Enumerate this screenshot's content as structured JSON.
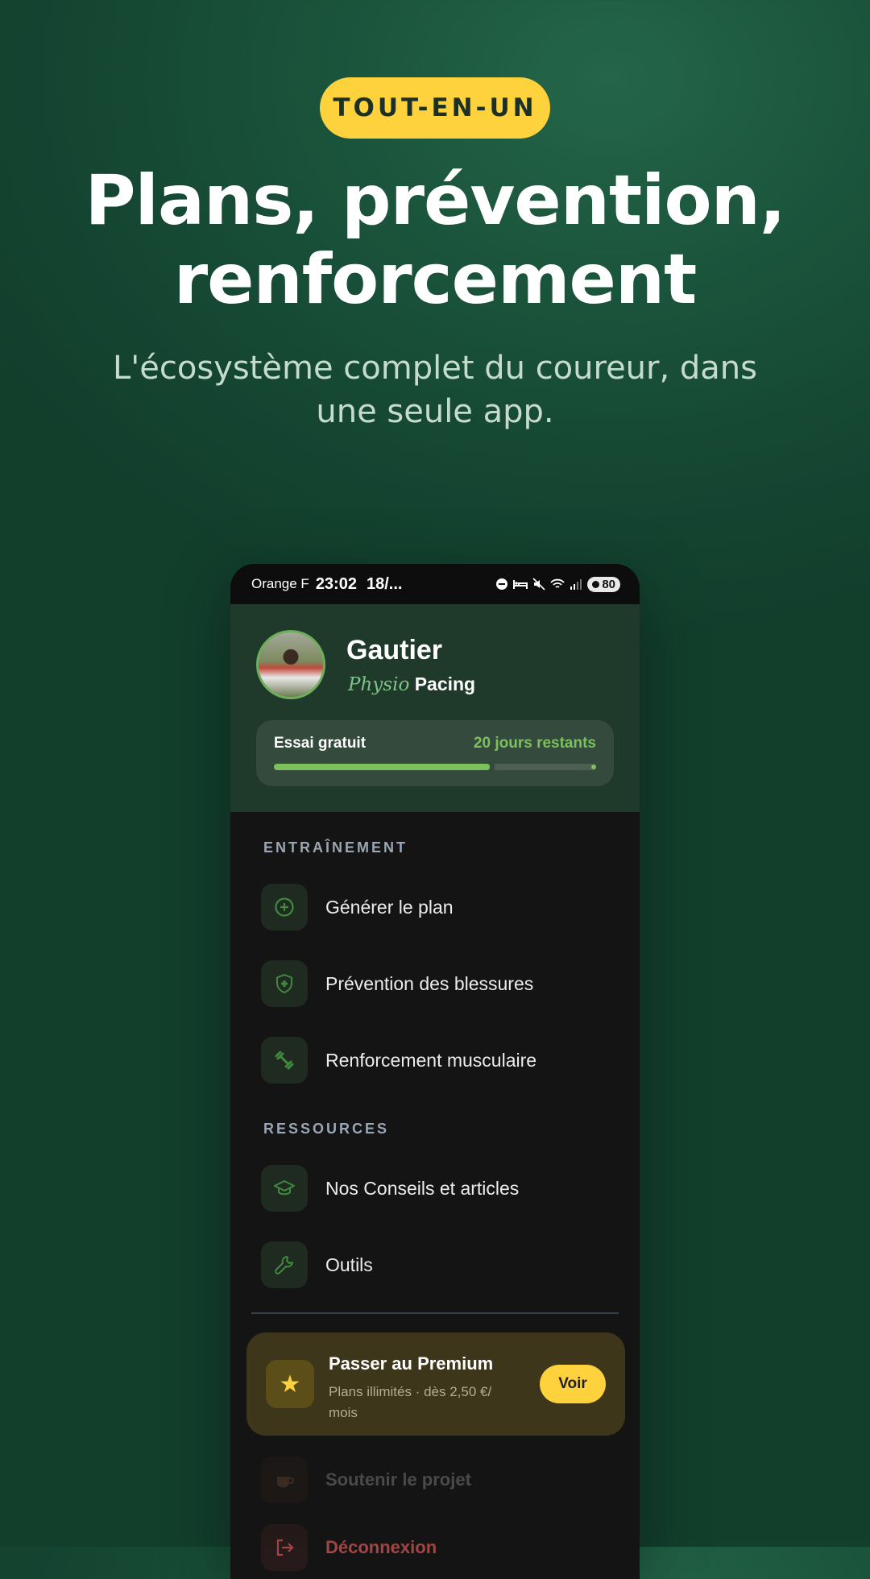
{
  "hero": {
    "badge": "TOUT-EN-UN",
    "headline_line1": "Plans, prévention,",
    "headline_line2": "renforcement",
    "subtitle": "L'écosystème complet du coureur, dans une seule app."
  },
  "status_bar": {
    "carrier": "Orange F",
    "time": "23:02",
    "date": "18/...",
    "battery": "80"
  },
  "profile": {
    "name": "Gautier",
    "brand_part1": "Physio",
    "brand_part2": "Pacing"
  },
  "trial": {
    "label": "Essai gratuit",
    "remaining": "20 jours restants",
    "progress": 0.67
  },
  "sections": {
    "training": "ENTRAÎNEMENT",
    "resources": "RESSOURCES"
  },
  "menu": {
    "generate_plan": "Générer le plan",
    "injury_prevention": "Prévention des blessures",
    "strength": "Renforcement musculaire",
    "articles": "Nos Conseils et articles",
    "tools": "Outils",
    "support": "Soutenir le projet",
    "logout": "Déconnexion"
  },
  "premium": {
    "title": "Passer au Premium",
    "subtitle": "Plans illimités · dès 2,50 €/ mois",
    "button": "Voir"
  },
  "colors": {
    "background": "#1b553c",
    "accent_yellow": "#fdd23d",
    "accent_green": "#7cc05e",
    "logout_red": "#e25b5b"
  },
  "icons": {
    "generate_plan": "plus-circle-icon",
    "injury_prevention": "shield-plus-icon",
    "strength": "dumbbell-icon",
    "articles": "graduation-cap-icon",
    "tools": "wrench-icon",
    "premium": "star-icon",
    "support": "coffee-icon",
    "logout": "logout-icon"
  }
}
